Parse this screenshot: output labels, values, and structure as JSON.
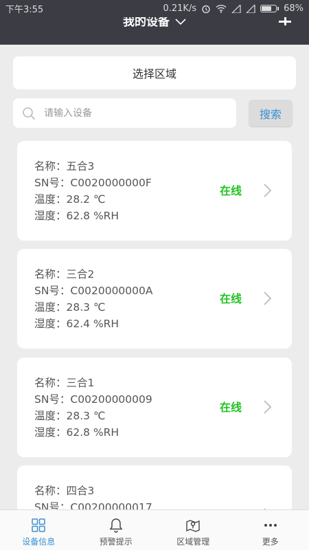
{
  "status_bar": {
    "time": "下午3:55",
    "speed": "0.21K/s",
    "battery": "68%"
  },
  "header": {
    "title": "我的设备",
    "add_icon": "plus-icon",
    "dropdown_icon": "chevron-down-icon"
  },
  "region": {
    "label": "选择区域"
  },
  "search": {
    "placeholder": "请输入设备",
    "value": "",
    "button_label": "搜索",
    "icon": "search-icon"
  },
  "devices": [
    {
      "name": "名称：五合3",
      "sn": "SN号：C0020000000F",
      "temp": "温度：28.2 ℃",
      "humidity": "湿度：62.8 %RH",
      "status": "在线"
    },
    {
      "name": "名称：三合2",
      "sn": "SN号：C0020000000A",
      "temp": "温度：28.3 ℃",
      "humidity": "湿度：62.4 %RH",
      "status": "在线"
    },
    {
      "name": "名称：三合1",
      "sn": "SN号：C00200000009",
      "temp": "温度：28.3 ℃",
      "humidity": "湿度：62.8 %RH",
      "status": "在线"
    },
    {
      "name": "名称：四合3",
      "sn": "SN号：C00200000017",
      "temp": "",
      "humidity": "",
      "status": ""
    }
  ],
  "tabs": [
    {
      "label": "设备信息",
      "icon": "grid-icon",
      "active": true
    },
    {
      "label": "预警提示",
      "icon": "bell-icon",
      "active": false
    },
    {
      "label": "区域管理",
      "icon": "map-pin-icon",
      "active": false
    },
    {
      "label": "更多",
      "icon": "more-icon",
      "active": false
    }
  ],
  "colors": {
    "header_bg": "#3c3d44",
    "online": "#22c322",
    "accent": "#3a8fd0",
    "page_bg": "#ececec"
  }
}
